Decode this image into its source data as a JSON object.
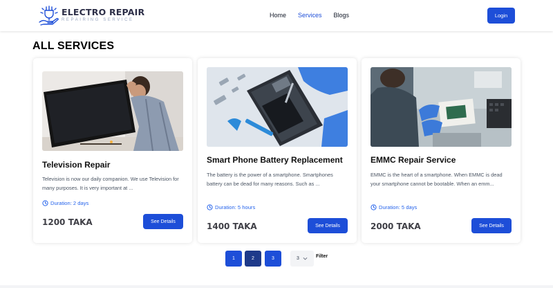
{
  "brand": {
    "title": "ELECTRO REPAIR",
    "subtitle": "REPAIRING SERVICE"
  },
  "nav": {
    "items": [
      "Home",
      "Services",
      "Blogs"
    ],
    "active": "Services"
  },
  "login_label": "Login",
  "page_heading": "ALL SERVICES",
  "services": [
    {
      "title": "Television Repair",
      "description": "Television is now our daily companion. We use Television for many purposes. It is very important at ...",
      "duration": "Duration: 2 days",
      "price": "1200 TAKA",
      "button": "See Details",
      "image": "technician-lifting-tv-photo"
    },
    {
      "title": "Smart Phone Battery Replacement",
      "description": "The battery is the power of a smartphone. Smartphones battery can be dead for many reasons. Such as ...",
      "duration": "Duration: 5 hours",
      "price": "1400 TAKA",
      "button": "See Details",
      "image": "phone-disassembly-photo"
    },
    {
      "title": "EMMC Repair Service",
      "description": "EMMC is the heart of a smartphone. When EMMC is dead your smartphone cannot be bootable. When an emm...",
      "duration": "Duration: 5 days",
      "price": "2000 TAKA",
      "button": "See Details",
      "image": "circuit-board-repair-photo"
    }
  ],
  "pagination": {
    "pages": [
      "1",
      "2",
      "3"
    ],
    "current": "2",
    "per_page": "3",
    "filter_label": "Filter"
  },
  "colors": {
    "primary": "#1d4ed8",
    "primary_dark": "#1e3a8a",
    "duration": "#2563eb"
  },
  "icons": {
    "duration": "clock-icon",
    "logo": "hand-plug-icon",
    "select": "chevron-down-icon"
  }
}
